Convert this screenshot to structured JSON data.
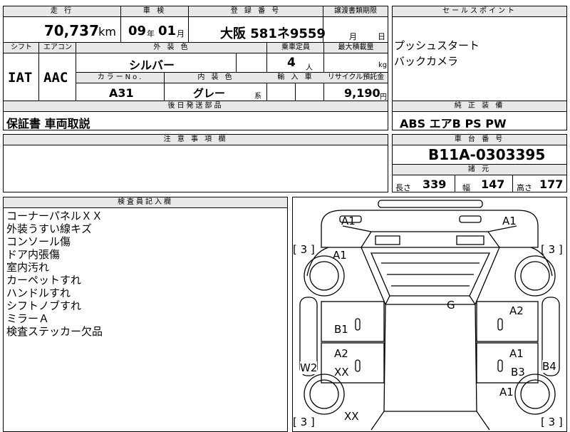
{
  "mileage": {
    "label": "走 行",
    "value": "70,737",
    "unit": "km"
  },
  "inspection": {
    "label": "車 検",
    "year": "09",
    "year_unit": "年",
    "month": "01",
    "month_unit": "月"
  },
  "registration": {
    "label": "登 録 番 号",
    "value": "大阪 581ネ9559"
  },
  "transfer_deadline": {
    "label": "譲渡書類期限",
    "month_unit": "月",
    "day_unit": "日"
  },
  "sale_points": {
    "label": "セールスポイント",
    "items": [
      "プッシュスタート",
      "バックカメラ"
    ]
  },
  "shift": {
    "label": "シフト",
    "value": "IAT"
  },
  "aircon": {
    "label": "エアコン",
    "value": "AAC"
  },
  "exterior_color": {
    "label": "外 装 色",
    "value": "シルバー"
  },
  "capacity": {
    "label": "乗車定員",
    "value": "4",
    "unit": "人"
  },
  "max_load": {
    "label": "最大積載量",
    "unit": "kg"
  },
  "color_no": {
    "label": "カラーNo.",
    "value": "A31"
  },
  "interior_color": {
    "label": "内 装 色",
    "value": "グレー",
    "suffix": "系"
  },
  "import": {
    "label": "輸 入 車"
  },
  "recycle": {
    "label": "リサイクル預託金",
    "value": "9,190",
    "unit": "円"
  },
  "later_delivery": {
    "label": "後日発送部品",
    "value": "保証書 車両取説"
  },
  "genuine_equipment": {
    "label": "純 正 装 備",
    "value": "ABS エアB PS PW"
  },
  "notes": {
    "label": "注 意 事 項 欄"
  },
  "chassis": {
    "label": "車 台 番 号",
    "value": "B11A-0303395"
  },
  "specs": {
    "label": "諸 元",
    "length_label": "長さ",
    "length": "339",
    "width_label": "幅",
    "width": "147",
    "height_label": "高さ",
    "height": "177"
  },
  "inspector": {
    "label": "検査員記入欄",
    "items": [
      "コーナーパネルＸＸ",
      "外装うすい線キズ",
      "コンソール傷",
      "ドア内張傷",
      "室内汚れ",
      "カーペットすれ",
      "ハンドルすれ",
      "シフトノブすれ",
      "ミラーＡ",
      "検査ステッカー欠品"
    ]
  },
  "diagram": {
    "marks": {
      "front_left": "A1",
      "front_right": "A1",
      "fender_left": "A1",
      "glass": "G",
      "door_fr": "A2",
      "door_fl": "B1",
      "door_rl": "A2",
      "door_rl2": "XX",
      "door_rr": "A1",
      "door_rr2": "B3",
      "sill_l": "W2",
      "sill_r": "B4",
      "quarter_r": "A1",
      "rear_l": "XX"
    },
    "tire_tl": "[ 3 ]",
    "tire_tr": "[ 3 ]",
    "tire_bl": "[ 3 ]",
    "tire_br": "[ 3 ]"
  }
}
